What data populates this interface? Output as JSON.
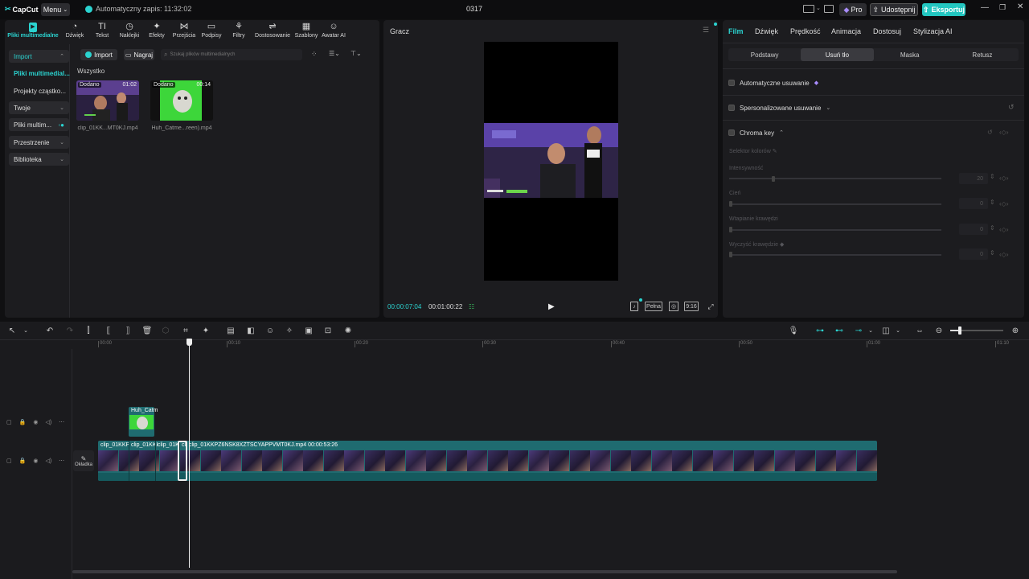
{
  "app": {
    "logo": "CapCut",
    "menu_label": "Menu",
    "autosave": "Automatyczny zapis: 11:32:02",
    "project_title": "0317",
    "pro_label": "Pro",
    "share_label": "Udostępnij",
    "export_label": "Eksportuj"
  },
  "toolbar": {
    "items": [
      {
        "label": "Pliki multimedialne",
        "icon": "media-icon"
      },
      {
        "label": "Dźwięk",
        "icon": "audio-icon"
      },
      {
        "label": "Tekst",
        "icon": "text-icon"
      },
      {
        "label": "Naklejki",
        "icon": "sticker-icon"
      },
      {
        "label": "Efekty",
        "icon": "effects-icon"
      },
      {
        "label": "Przejścia",
        "icon": "transition-icon"
      },
      {
        "label": "Podpisy",
        "icon": "captions-icon"
      },
      {
        "label": "Filtry",
        "icon": "filter-icon"
      },
      {
        "label": "Dostosowanie",
        "icon": "adjust-icon"
      },
      {
        "label": "Szablony",
        "icon": "templates-icon"
      },
      {
        "label": "Awatar AI",
        "icon": "avatar-icon"
      }
    ]
  },
  "sidebar": {
    "items": [
      {
        "label": "Import"
      },
      {
        "label": "Pliki multimedial..."
      },
      {
        "label": "Projekty cząstko..."
      },
      {
        "label": "Twoje"
      },
      {
        "label": "Pliki multim..."
      },
      {
        "label": "Przestrzenie"
      },
      {
        "label": "Biblioteka"
      }
    ]
  },
  "media": {
    "import_label": "Import",
    "record_label": "Nagraj",
    "search_placeholder": "Szukaj plików multimedialnych",
    "section_label": "Wszystko",
    "items": [
      {
        "tag": "Dodano",
        "duration": "01:02",
        "name": "clip_01KK...MT0KJ.mp4"
      },
      {
        "tag": "Dodano",
        "duration": "00:14",
        "name": "Huh_Catme...reen).mp4"
      }
    ]
  },
  "player": {
    "title": "Gracz",
    "current_time": "00:00:07:04",
    "total_time": "00:01:00:22",
    "full_label": "Pełna",
    "ratio_label": "9:16"
  },
  "properties": {
    "tabs": [
      "Film",
      "Dźwięk",
      "Prędkość",
      "Animacja",
      "Dostosuj",
      "Stylizacja AI"
    ],
    "subtabs": [
      "Podstawy",
      "Usuń tło",
      "Maska",
      "Retusz"
    ],
    "auto_remove": "Automatyczne usuwanie",
    "custom_remove": "Spersonalizowane usuwanie",
    "chroma_key": "Chroma key",
    "color_picker": "Selektor kolorów",
    "intensity_label": "Intensywność",
    "intensity_value": "20",
    "shadow_label": "Cień",
    "shadow_value": "0",
    "edge_feather_label": "Wtapianie krawędzi",
    "edge_feather_value": "0",
    "edge_clean_label": "Wyczyść krawędzie",
    "edge_clean_value": "0"
  },
  "timeline": {
    "ruler": [
      "00:00",
      "00:10",
      "00:20",
      "00:30",
      "00:40",
      "00:50",
      "01:00",
      "01:10"
    ],
    "overlay_clip_label": "Huh_Catm",
    "cover_label": "Okładka",
    "main_clips": [
      "clip_01KKP",
      "clip_01KKI",
      "clip_01K",
      "cli",
      "clip_01KKPZ6NSK8XZTSCYAPPVMT0KJ.mp4  00:00:53:26"
    ]
  },
  "colors": {
    "accent": "#2bd3d0",
    "export": "#22c6c0",
    "clip_bg": "#1f6b70",
    "green_screen": "#3dd63a"
  }
}
